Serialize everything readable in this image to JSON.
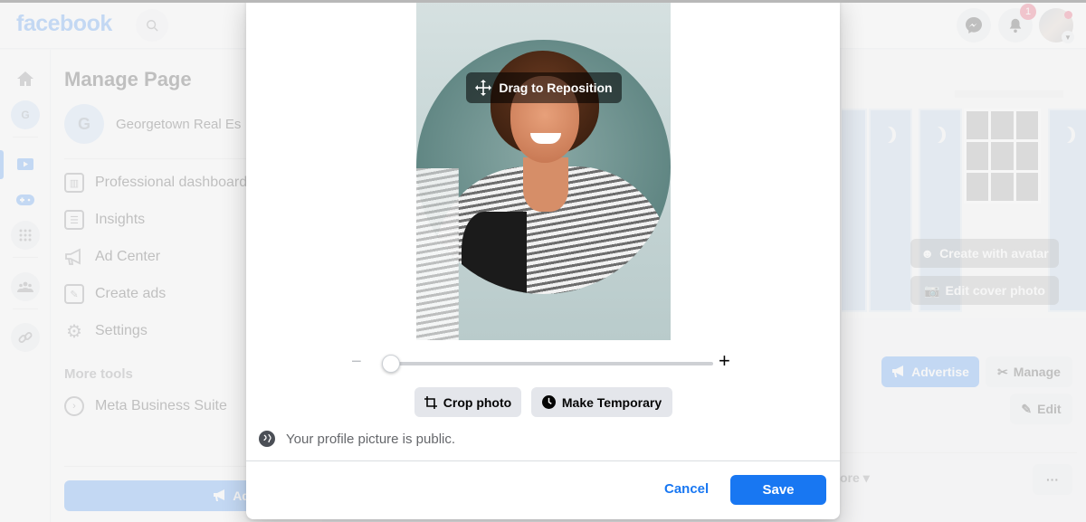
{
  "header": {
    "logo": "facebook",
    "search_icon": "🔍",
    "notification_count": "1"
  },
  "left_rail": {
    "icons": [
      "home-icon",
      "page-avatar-icon",
      "watch-icon",
      "gaming-icon",
      "apps-grid-icon",
      "groups-icon",
      "link-icon"
    ],
    "page_initial": "G"
  },
  "manage_panel": {
    "title": "Manage Page",
    "page_initial": "G",
    "page_name": "Georgetown Real Es",
    "items": [
      {
        "label": "Professional dashboard",
        "icon": "dashboard-icon"
      },
      {
        "label": "Insights",
        "icon": "insights-icon"
      },
      {
        "label": "Ad Center",
        "icon": "megaphone-icon"
      },
      {
        "label": "Create ads",
        "icon": "edit-icon"
      },
      {
        "label": "Settings",
        "icon": "gear-icon"
      }
    ],
    "more_tools_label": "More tools",
    "more_tools": [
      {
        "label": "Meta Business Suite",
        "icon": "meta-business-icon"
      }
    ],
    "advertise_label": "Advertise"
  },
  "cover": {
    "create_avatar_label": "Create with avatar",
    "edit_cover_label": "Edit cover photo"
  },
  "page_actions": {
    "advertise_label": "Advertise",
    "manage_label": "Manage",
    "edit_label": "Edit",
    "more_label": "ore",
    "ellipsis_label": "···"
  },
  "modal": {
    "drag_label": "Drag to Reposition",
    "zoom": {
      "minus": "−",
      "plus": "+",
      "value_percent": 0
    },
    "crop_label": "Crop photo",
    "temporary_label": "Make Temporary",
    "privacy_text": "Your profile picture is public.",
    "cancel_label": "Cancel",
    "save_label": "Save"
  },
  "colors": {
    "brand": "#1877f2",
    "badge": "#e41e3f"
  }
}
